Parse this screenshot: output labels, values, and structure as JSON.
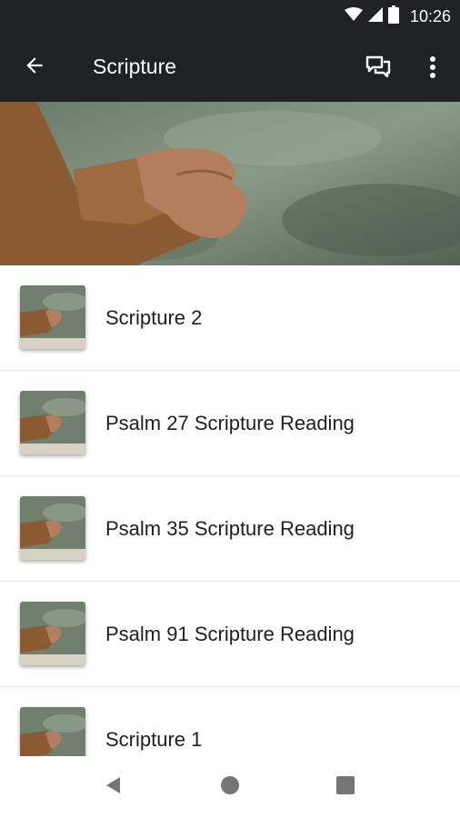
{
  "status_bar": {
    "time": "10:26",
    "icons": [
      "wifi-icon",
      "signal-icon",
      "battery-icon"
    ]
  },
  "app_bar": {
    "title": "Scripture",
    "icons": [
      "back-arrow-icon",
      "chat-icon",
      "more-vert-icon"
    ],
    "background": "#202124"
  },
  "hero": {
    "image": "hands-clasped-photo"
  },
  "list": {
    "items": [
      {
        "label": "Scripture 2",
        "thumbnail": "hands-clasped-thumbnail"
      },
      {
        "label": "Psalm 27 Scripture Reading",
        "thumbnail": "hands-clasped-thumbnail"
      },
      {
        "label": "Psalm 35 Scripture Reading",
        "thumbnail": "hands-clasped-thumbnail"
      },
      {
        "label": "Psalm 91 Scripture Reading",
        "thumbnail": "hands-clasped-thumbnail"
      },
      {
        "label": "Scripture 1",
        "thumbnail": "hands-clasped-thumbnail"
      }
    ]
  },
  "nav_bar": {
    "icons": [
      "back-triangle-icon",
      "home-circle-icon",
      "recents-square-icon"
    ]
  }
}
